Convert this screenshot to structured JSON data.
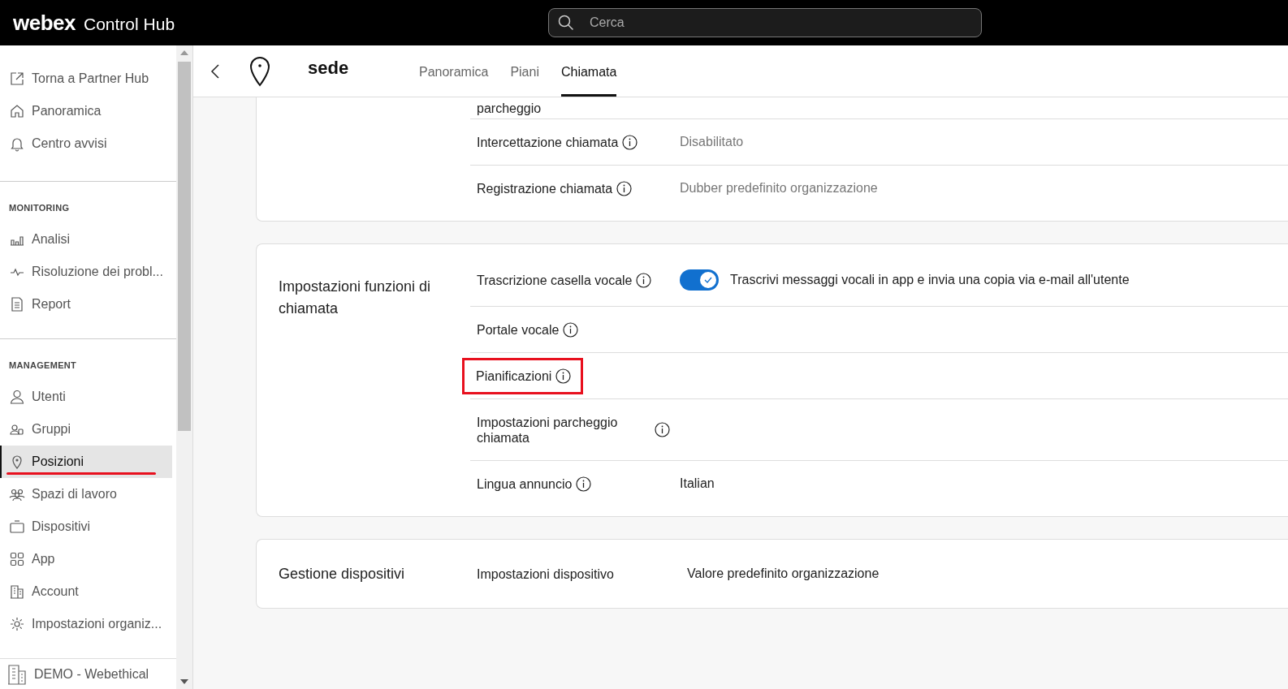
{
  "topbar": {
    "logo": "webex",
    "product": "Control Hub",
    "search": {
      "placeholder": "Cerca"
    }
  },
  "sidebar": {
    "groups": [
      {
        "items": [
          {
            "label": "Torna a Partner Hub",
            "selected": false,
            "annotated": false
          },
          {
            "label": "Panoramica",
            "selected": false,
            "annotated": false
          },
          {
            "label": "Centro avvisi",
            "selected": false,
            "annotated": false
          }
        ]
      },
      {
        "heading": "MONITORING",
        "items": [
          {
            "label": "Analisi",
            "selected": false,
            "annotated": false
          },
          {
            "label": "Risoluzione dei probl...",
            "selected": false,
            "annotated": false
          },
          {
            "label": "Report",
            "selected": false,
            "annotated": false
          }
        ]
      },
      {
        "heading": "MANAGEMENT",
        "items": [
          {
            "label": "Utenti",
            "selected": false,
            "annotated": false
          },
          {
            "label": "Gruppi",
            "selected": false,
            "annotated": false
          },
          {
            "label": "Posizioni",
            "selected": true,
            "annotated": true
          },
          {
            "label": "Spazi di lavoro",
            "selected": false,
            "annotated": false
          },
          {
            "label": "Dispositivi",
            "selected": false,
            "annotated": false
          },
          {
            "label": "App",
            "selected": false,
            "annotated": false
          },
          {
            "label": "Account",
            "selected": false,
            "annotated": false
          },
          {
            "label": "Impostazioni organiz...",
            "selected": false,
            "annotated": false
          }
        ]
      }
    ],
    "footer": "DEMO - Webethical"
  },
  "header": {
    "title": "sede",
    "tabs": [
      {
        "label": "Panoramica",
        "selected": false
      },
      {
        "label": "Piani",
        "selected": false
      },
      {
        "label": "Chiamata",
        "selected": true
      }
    ]
  },
  "sections": [
    {
      "rows": [
        {
          "label": "parcheggio",
          "info": false,
          "highlighted": false
        },
        {
          "label": "Intercettazione chiamata",
          "info": true,
          "highlighted": false,
          "value": "Disabilitato",
          "muted": true
        },
        {
          "label": "Registrazione chiamata",
          "info": true,
          "highlighted": false,
          "value": "Dubber predefinito organizzazione",
          "muted": true
        }
      ]
    },
    {
      "title": "Impostazioni funzioni di chiamata",
      "rows": [
        {
          "label": "Trascrizione casella vocale",
          "info": true,
          "highlighted": false,
          "toggle": {
            "on": true,
            "label": "Trascrivi messaggi vocali in app e invia una copia via e-mail all'utente"
          }
        },
        {
          "label": "Portale vocale",
          "info": true,
          "highlighted": false
        },
        {
          "label": "Pianificazioni",
          "info": true,
          "highlighted": true
        },
        {
          "label": "Impostazioni parcheggio chiamata",
          "info": true,
          "highlighted": false,
          "wide": true
        },
        {
          "label": "Lingua annuncio",
          "info": true,
          "highlighted": false,
          "value": "Italian",
          "muted": false
        }
      ]
    },
    {
      "title": "Gestione dispositivi",
      "rows": [
        {
          "label": "Impostazioni dispositivo",
          "info": false,
          "highlighted": false,
          "value": "Valore predefinito organizzazione",
          "muted": false
        }
      ]
    }
  ]
}
